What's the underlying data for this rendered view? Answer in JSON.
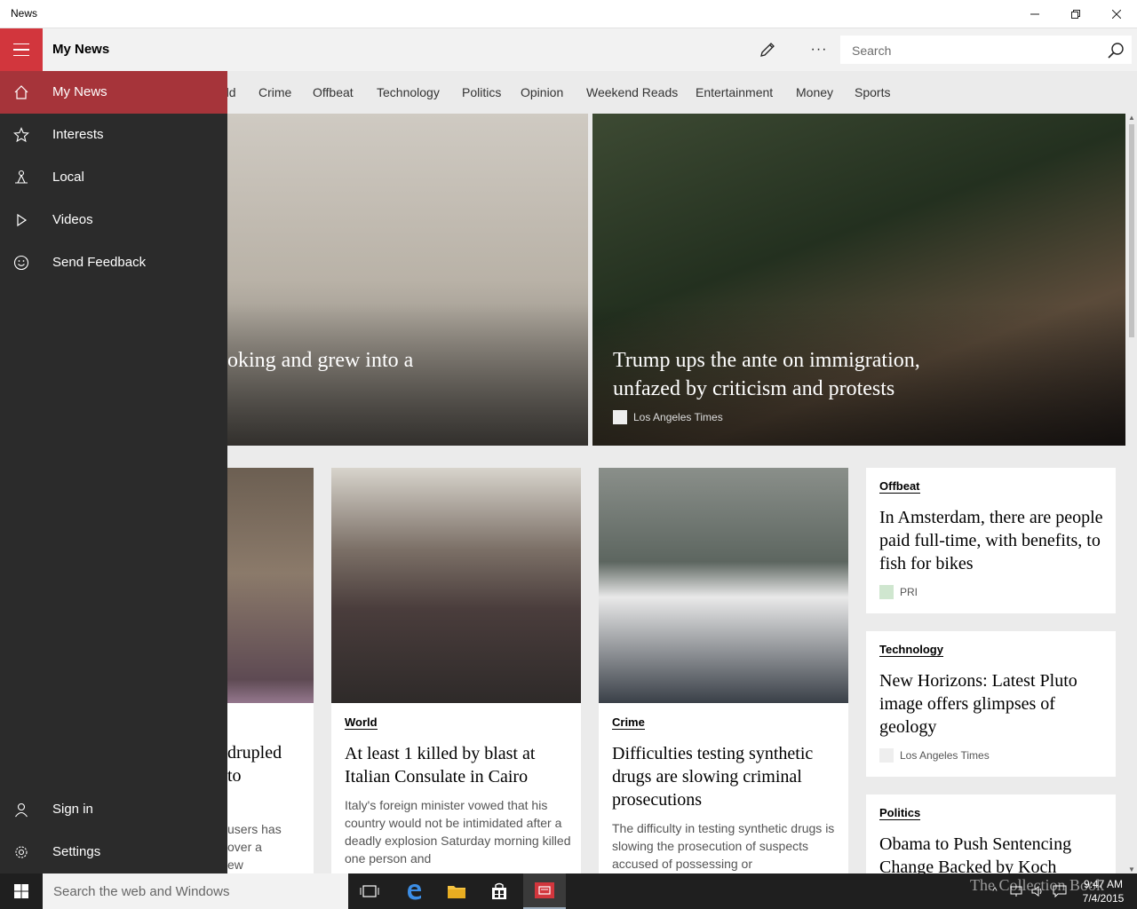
{
  "window": {
    "title": "News"
  },
  "header": {
    "page_title": "My News",
    "search_placeholder": "Search",
    "more_label": "···"
  },
  "categories": [
    "rld",
    "Crime",
    "Offbeat",
    "Technology",
    "Politics",
    "Opinion",
    "Weekend Reads",
    "Entertainment",
    "Money",
    "Sports"
  ],
  "sidebar": {
    "items": [
      {
        "label": "My News",
        "icon": "home-icon",
        "active": true
      },
      {
        "label": "Interests",
        "icon": "star-icon"
      },
      {
        "label": "Local",
        "icon": "local-icon"
      },
      {
        "label": "Videos",
        "icon": "play-icon"
      },
      {
        "label": "Send Feedback",
        "icon": "smiley-icon"
      }
    ],
    "bottom_items": [
      {
        "label": "Sign in",
        "icon": "person-icon"
      },
      {
        "label": "Settings",
        "icon": "gear-icon"
      }
    ]
  },
  "hero": [
    {
      "headline": "oking and grew into a"
    },
    {
      "headline": "Trump ups the ante on immigration, unfazed by criticism and protests",
      "source": "Los Angeles Times"
    }
  ],
  "cards": {
    "partial": {
      "title": "drupled\nto",
      "desc": "users has\nover a\new"
    },
    "world": {
      "category": "World",
      "title": "At least 1 killed by blast at Italian Consulate in Cairo",
      "desc": "Italy's foreign minister vowed that his country would not be intimidated after a deadly explosion Saturday morning killed one person and"
    },
    "crime": {
      "category": "Crime",
      "title": "Difficulties testing synthetic drugs are slowing criminal prosecutions",
      "desc": "The difficulty in testing synthetic drugs is slowing the prosecution of suspects accused of possessing or"
    },
    "offbeat": {
      "category": "Offbeat",
      "title": "In Amsterdam, there are people paid full-time, with benefits, to fish for bikes",
      "source": "PRI"
    },
    "technology": {
      "category": "Technology",
      "title": "New Horizons: Latest Pluto image offers glimpses of geology",
      "source": "Los Angeles Times"
    },
    "politics": {
      "category": "Politics",
      "title": "Obama to Push Sentencing Change Backed by Koch"
    }
  },
  "taskbar": {
    "search_placeholder": "Search the web and Windows",
    "time": "9:47 AM",
    "date": "7/4/2015",
    "watermark": "The Collection Book"
  },
  "colors": {
    "accent": "#d2363d",
    "active_nav": "#a6343a",
    "sidebar_bg": "#2b2b2b"
  }
}
